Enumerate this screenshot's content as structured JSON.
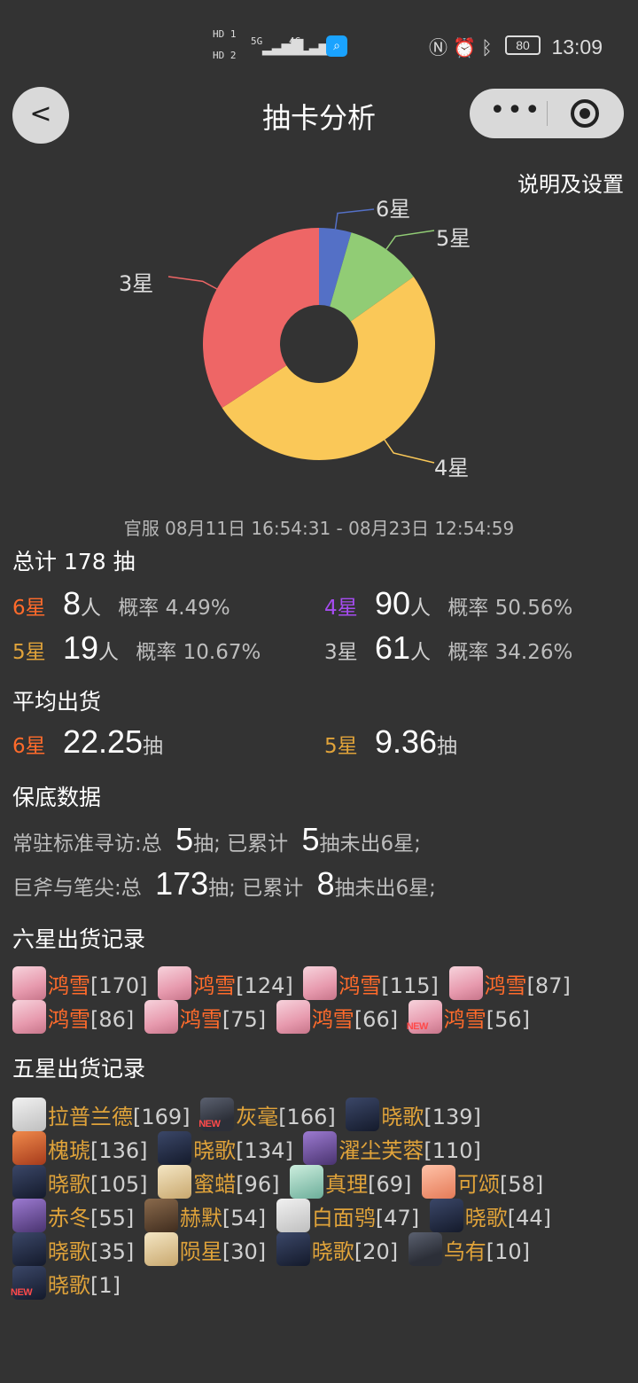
{
  "status_bar": {
    "time": "13:09",
    "battery": "80",
    "sig_labels": [
      "HD 1",
      "HD 2",
      "5G",
      "4G"
    ],
    "icons": [
      "nfc-icon",
      "alarm-icon",
      "bluetooth-icon"
    ]
  },
  "navbar": {
    "back_label": "<",
    "title": "抽卡分析",
    "more_label": "•••"
  },
  "settings_link": "说明及设置",
  "chart_data": {
    "type": "pie",
    "donut": true,
    "categories": [
      "6星",
      "5星",
      "4星",
      "3星"
    ],
    "values": [
      8,
      19,
      90,
      61
    ],
    "colors": [
      "#5470c6",
      "#91cc75",
      "#fac858",
      "#ee6666"
    ]
  },
  "range_text": "官服  08月11日 16:54:31  -  08月23日 12:54:59",
  "summary": {
    "total_label": "总计 178 抽",
    "rows": [
      {
        "star": "6星",
        "count": "8",
        "unit": "人",
        "prob_label": "概率",
        "prob": "4.49%"
      },
      {
        "star": "4星",
        "count": "90",
        "unit": "人",
        "prob_label": "概率",
        "prob": "50.56%"
      },
      {
        "star": "5星",
        "count": "19",
        "unit": "人",
        "prob_label": "概率",
        "prob": "10.67%"
      },
      {
        "star": "3星",
        "count": "61",
        "unit": "人",
        "prob_label": "概率",
        "prob": "34.26%"
      }
    ]
  },
  "average": {
    "title": "平均出货",
    "six_star": "6星",
    "six_value": "22.25",
    "six_unit": "抽",
    "five_star": "5星",
    "five_value": "9.36",
    "five_unit": "抽"
  },
  "pity": {
    "title": "保底数据",
    "lines": [
      {
        "pool": "常驻标准寻访:总",
        "total": "5",
        "mid": "抽;  已累计",
        "acc": "5",
        "tail": "抽未出6星;"
      },
      {
        "pool": "巨斧与笔尖:总",
        "total": "173",
        "mid": "抽;  已累计",
        "acc": "8",
        "tail": "抽未出6星;"
      }
    ]
  },
  "six_records": {
    "title": "六星出货记录",
    "items": [
      {
        "name": "鸿雪",
        "pull": "[170]"
      },
      {
        "name": "鸿雪",
        "pull": "[124]"
      },
      {
        "name": "鸿雪",
        "pull": "[115]"
      },
      {
        "name": "鸿雪",
        "pull": "[87]"
      },
      {
        "name": "鸿雪",
        "pull": "[86]"
      },
      {
        "name": "鸿雪",
        "pull": "[75]"
      },
      {
        "name": "鸿雪",
        "pull": "[66]"
      },
      {
        "name": "鸿雪",
        "pull": "[56]",
        "new": "NEW"
      }
    ]
  },
  "five_records": {
    "title": "五星出货记录",
    "items": [
      {
        "name": "拉普兰德",
        "pull": "[169]"
      },
      {
        "name": "灰毫",
        "pull": "[166]",
        "new": "NEW"
      },
      {
        "name": "晓歌",
        "pull": "[139]"
      },
      {
        "name": "槐琥",
        "pull": "[136]"
      },
      {
        "name": "晓歌",
        "pull": "[134]"
      },
      {
        "name": "濯尘芙蓉",
        "pull": "[110]"
      },
      {
        "name": "晓歌",
        "pull": "[105]"
      },
      {
        "name": "蜜蜡",
        "pull": "[96]"
      },
      {
        "name": "真理",
        "pull": "[69]"
      },
      {
        "name": "可颂",
        "pull": "[58]"
      },
      {
        "name": "赤冬",
        "pull": "[55]"
      },
      {
        "name": "赫默",
        "pull": "[54]"
      },
      {
        "name": "白面鸮",
        "pull": "[47]"
      },
      {
        "name": "晓歌",
        "pull": "[44]"
      },
      {
        "name": "晓歌",
        "pull": "[35]"
      },
      {
        "name": "陨星",
        "pull": "[30]"
      },
      {
        "name": "晓歌",
        "pull": "[20]"
      },
      {
        "name": "乌有",
        "pull": "[10]"
      },
      {
        "name": "晓歌",
        "pull": "[1]",
        "new": "NEW"
      }
    ]
  }
}
